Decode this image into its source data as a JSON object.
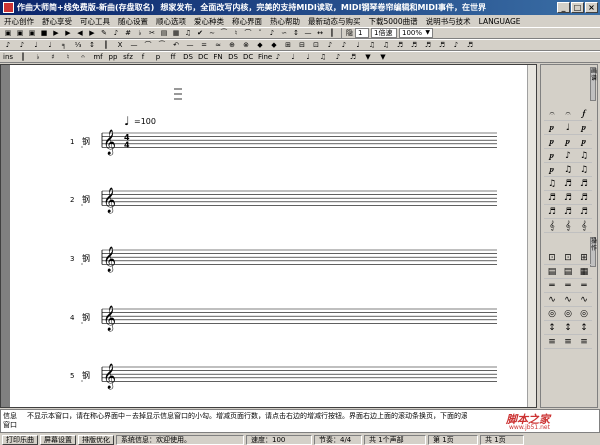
{
  "window": {
    "title": "作曲大师简+线免费版-新曲(存盘取名)",
    "promo": "想家发布，全面改写内核，完美的支持MIDI读取，MIDI钢琴卷帘编辑和MIDI事件，在世界",
    "buttons": [
      "_",
      "□",
      "×"
    ]
  },
  "menu": [
    "开心创作",
    "舒心享受",
    "可心工具",
    "随心设置",
    "顺心选项",
    "爱心种类",
    "称心界面",
    "热心帮助",
    "最新动态与购买",
    "下载5000曲谱",
    "说明书与技术",
    "LANGUAGE"
  ],
  "toolbar1": {
    "left": [
      "▣",
      "▣",
      "▣",
      "■",
      "▶",
      "▶",
      "◀",
      "▶",
      "✎",
      "♪",
      "#",
      "♭",
      "✂",
      "▤",
      "▦",
      "♫",
      "✔",
      "∼",
      "⁀",
      "♮",
      "⌒",
      "˘",
      "♪",
      "∽",
      "↕",
      "—",
      "↔",
      "┃"
    ],
    "spin_label": "隐",
    "spin_value": "1",
    "combo_value": "1倍速",
    "zoom_value": "100%"
  },
  "toolbar2": [
    "♪",
    "♪",
    "♩",
    "♩",
    "╕",
    "⅓",
    "↕",
    "┃",
    "X",
    "—",
    "⌒",
    "⁀",
    "↶",
    "—",
    "=",
    "≈",
    "⊕",
    "⊗",
    "◆",
    "◆",
    "⊞",
    "⊟",
    "⊡",
    "♪",
    "♪",
    "♩",
    "♫",
    "♫",
    "♬",
    "♬",
    "♬",
    "♬",
    "♪",
    "♬"
  ],
  "toolbar3": [
    "ins",
    "║",
    "♭",
    "♯",
    "♮",
    "𝄐",
    "mf",
    "pp",
    "sfz",
    "f",
    "p",
    "ff",
    "DS",
    "DC",
    "FN",
    "DS",
    "DC",
    "Fine",
    "♪",
    "♩",
    "♩",
    "♫",
    "♪",
    "♬",
    "▼",
    "▼"
  ],
  "score": {
    "tempo_label": "=100",
    "staff_label": "钢",
    "systems": [
      "1",
      "2",
      "3",
      "4",
      "5"
    ],
    "time_signature": [
      "4",
      "4"
    ]
  },
  "palette": {
    "tab_top": "画谱",
    "tab_mid": "操作",
    "rows_top": [
      "𝄐",
      "𝄐",
      "𝆑",
      "𝆏",
      "♩",
      "𝆏",
      "𝆏",
      "𝆏",
      "𝆏",
      "𝆏",
      "♪",
      "♫",
      "𝆏",
      "♫",
      "♫",
      "♫",
      "♬",
      "♬",
      "♬",
      "♬",
      "♬",
      "♬",
      "♬",
      "♬",
      "𝄞",
      "𝄞",
      "𝄞"
    ],
    "rows_bottom": [
      "⊡",
      "⊡",
      "⊞",
      "▤",
      "▤",
      "▦",
      "═",
      "═",
      "═",
      "∿",
      "∿",
      "∿",
      "◎",
      "◎",
      "◎",
      "↕",
      "↕",
      "↕",
      "≡",
      "≡",
      "≡"
    ]
  },
  "info": {
    "label": "信息窗口",
    "text": "不显示本窗口，请在称心界面中－去掉显示信息窗口的小勾。增减页面行数，请点击右边的增减行按钮。界面右边上面的滚动条换页，下面的滚动条将当前为",
    "watermark": "脚本之家",
    "watermark_url": "www.jb51.net"
  },
  "status": {
    "buttons": [
      "打印乐曲",
      "屏幕设置",
      "排版优化"
    ],
    "system_info": "系统信息：欢迎使用。",
    "speed": "速度：100",
    "beat": "节奏：4/4",
    "parts": "共 1个声部",
    "page": "第 1页",
    "pages": "共 1页"
  }
}
